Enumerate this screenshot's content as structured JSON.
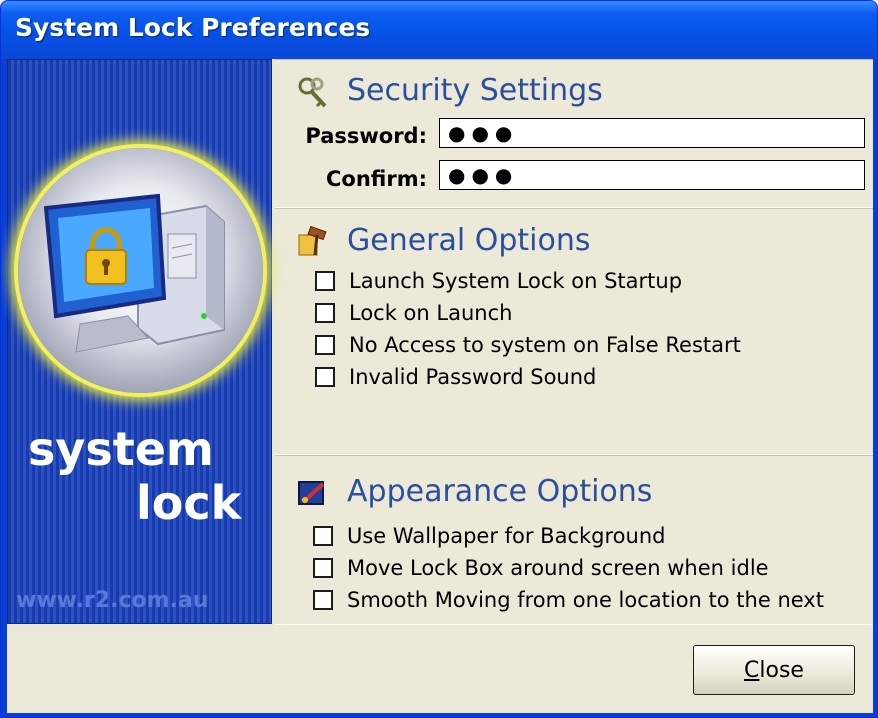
{
  "window": {
    "title": "System Lock Preferences"
  },
  "side": {
    "brand_line1": "system",
    "brand_line2": "lock",
    "url": "www.r2.com.au"
  },
  "security": {
    "title": "Security Settings",
    "password_label": "Password:",
    "password_value": "●●●",
    "confirm_label": "Confirm:",
    "confirm_value": "●●●"
  },
  "general": {
    "title": "General Options",
    "options": [
      {
        "label": "Launch System Lock on Startup",
        "checked": false
      },
      {
        "label": "Lock on Launch",
        "checked": false
      },
      {
        "label": "No Access to system on False Restart",
        "checked": false
      },
      {
        "label": "Invalid Password Sound",
        "checked": false
      }
    ]
  },
  "appearance": {
    "title": "Appearance Options",
    "options": [
      {
        "label": "Use Wallpaper for Background",
        "checked": false
      },
      {
        "label": "Move Lock Box around screen when idle",
        "checked": false
      },
      {
        "label": "Smooth Moving from one location to the next",
        "checked": false
      }
    ]
  },
  "buttons": {
    "close_first": "C",
    "close_rest": "lose"
  },
  "icons": {
    "security": "keys-icon",
    "general": "tools-icon",
    "appearance": "paint-icon",
    "side": "computer-lock-icon"
  }
}
